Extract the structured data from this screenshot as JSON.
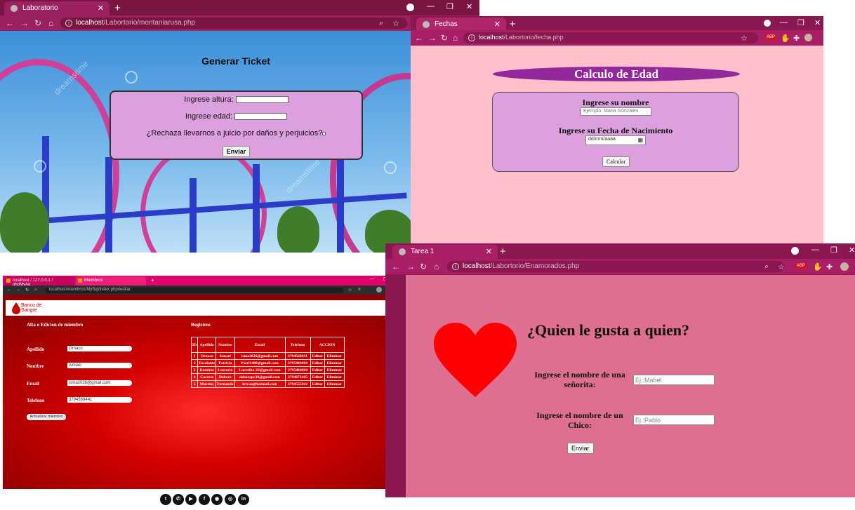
{
  "windows": {
    "roller": {
      "tab_title": "Laboratorio",
      "url_host": "localhost",
      "url_path": "/Labortorio/montaniarusa.php",
      "title": "Generar Ticket",
      "altura_label": "Ingrese altura:",
      "edad_label": "Ingrese edad:",
      "juicio_label": "¿Rechaza llevarnos a juicio por daños y perjuicios?",
      "submit_label": "Enviar",
      "watermark": "dreamstime"
    },
    "fechas": {
      "tab_title": "Fechas",
      "url_host": "localhost",
      "url_path": "/Labortorio/fecha.php",
      "title": "Calculo de Edad",
      "nombre_label": "Ingrese su nombre",
      "nombre_placeholder": "Ejemplo: Maria Gonzales",
      "fecha_label": "Ingrese su Fecha de Nacimiento",
      "fecha_placeholder": "dd/mm/aaaa",
      "submit_label": "Calcular"
    },
    "banco": {
      "tab1_title": "localhost / 127.0.0.1 / phpMyAd",
      "tab2_title": "Miembros",
      "url": "localhost/miembros/MySql/index.php#editar",
      "logo_text": "Banco de Sangre",
      "form_title": "Alta o Edicion de miembro",
      "labels": {
        "apellido": "Apellido",
        "nombre": "Nombre",
        "email": "Email",
        "telefono": "Telefono"
      },
      "values": {
        "apellido": "Ornaco",
        "nombre": "Ismael",
        "email": "isma2026@gmail.com",
        "telefono": "3794568441"
      },
      "update_label": "Actualizar miembro",
      "registros_title": "Registros",
      "table": {
        "headers": [
          "ID",
          "Apellido",
          "Nombre",
          "Email",
          "Telefono",
          "ACCION"
        ],
        "rows": [
          [
            "1",
            "Ornaco",
            "Ismael",
            "isma2026@gmail.com",
            "3794568441"
          ],
          [
            "2",
            "Escalante",
            "Patricia",
            "Patri1408@gmail.com",
            "3795484484"
          ],
          [
            "3",
            "Ramirez",
            "Lucrecia",
            "Lucrelita-22@gmail.com",
            "3795484484"
          ],
          [
            "4",
            "Caceres",
            "Debora",
            "deborapc30@gmail.com",
            "3794673105"
          ],
          [
            "5",
            "Morales",
            "Fernando",
            "fercaa@hotmail.com",
            "3794555442"
          ]
        ],
        "edit_label": "Editar",
        "delete_label": "Eliminar"
      },
      "social": [
        "twitter-icon",
        "whatsapp-icon",
        "youtube-icon",
        "facebook-icon",
        "github-icon",
        "instagram-icon",
        "linkedin-icon"
      ]
    },
    "enamorados": {
      "tab_title": "Tarea 1",
      "url_host": "localhost",
      "url_path": "/Labortorio/Enamorados.php",
      "title": "¿Quien le gusta a quien?",
      "senorita_label": "Ingrese el nombre de una señorita:",
      "senorita_placeholder": "Ej.:Mabel",
      "chico_label": "Ingrese el nombre de un Chico:",
      "chico_placeholder": "Ej.:Pablo",
      "submit_label": "Enviar"
    }
  },
  "colors": {
    "chrome_dark": "#7a1542",
    "chrome_mid": "#8a1750",
    "pink_bg": "#ffc0cc",
    "lilac_box": "#dca0de",
    "love_bg": "#de6f91",
    "heart": "#ff0000"
  }
}
